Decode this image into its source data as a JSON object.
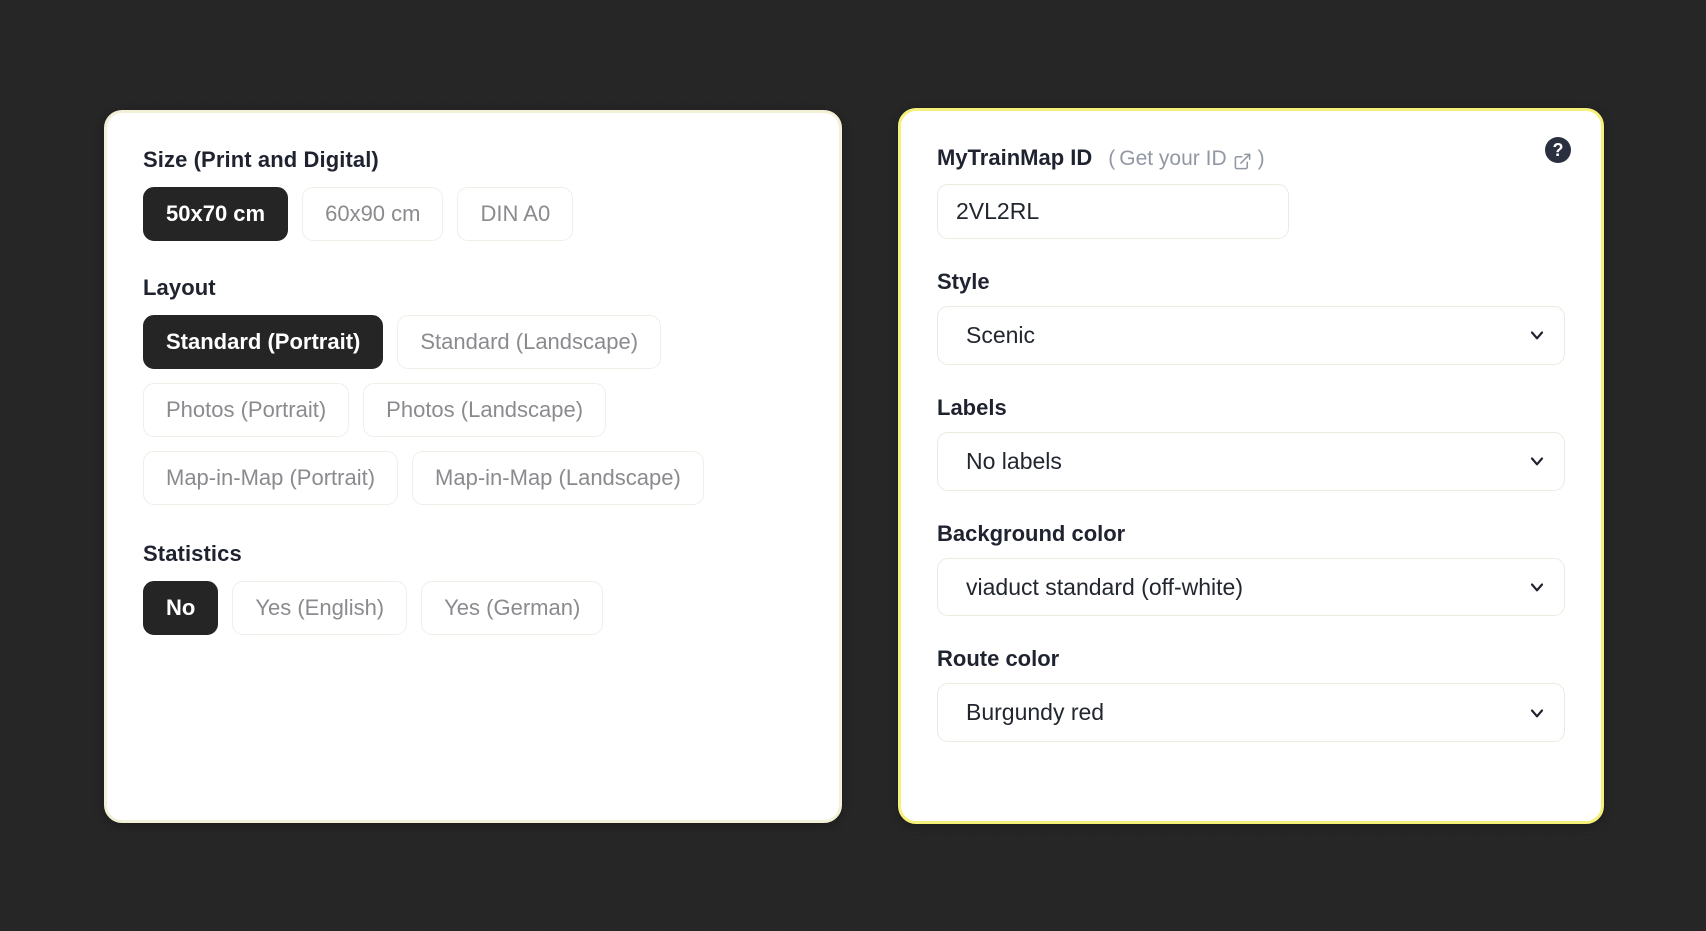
{
  "left_panel": {
    "size_group": {
      "label": "Size (Print and Digital)",
      "options": [
        {
          "label": "50x70 cm",
          "selected": true
        },
        {
          "label": "60x90 cm",
          "selected": false
        },
        {
          "label": "DIN A0",
          "selected": false
        }
      ]
    },
    "layout_group": {
      "label": "Layout",
      "options": [
        {
          "label": "Standard (Portrait)",
          "selected": true
        },
        {
          "label": "Standard (Landscape)",
          "selected": false
        },
        {
          "label": "Photos (Portrait)",
          "selected": false
        },
        {
          "label": "Photos (Landscape)",
          "selected": false
        },
        {
          "label": "Map-in-Map (Portrait)",
          "selected": false
        },
        {
          "label": "Map-in-Map (Landscape)",
          "selected": false
        }
      ]
    },
    "statistics_group": {
      "label": "Statistics",
      "options": [
        {
          "label": "No",
          "selected": true
        },
        {
          "label": "Yes (English)",
          "selected": false
        },
        {
          "label": "Yes (German)",
          "selected": false
        }
      ]
    }
  },
  "right_panel": {
    "id_field": {
      "label": "MyTrainMap ID",
      "link_open_paren": "(",
      "link_text": "Get your ID",
      "link_close_paren": ")",
      "link_icon": "external-link-icon",
      "value": "2VL2RL"
    },
    "help_icon": {
      "name": "help-icon",
      "glyph": "?"
    },
    "style_field": {
      "label": "Style",
      "value": "Scenic"
    },
    "labels_field": {
      "label": "Labels",
      "value": "No labels"
    },
    "background_color_field": {
      "label": "Background color",
      "value": "viaduct standard (off-white)"
    },
    "route_color_field": {
      "label": "Route color",
      "value": "Burgundy red"
    }
  },
  "colors": {
    "page_background": "#262626",
    "card_background": "#ffffff",
    "selected_button_background": "#252525",
    "selected_button_text": "#ffffff",
    "unselected_button_text": "#8b8b8f",
    "label_text": "#1f2330",
    "muted_text": "#9298a3",
    "left_card_border": "#f3f0d8",
    "right_card_border": "#f5f07a",
    "help_icon_background": "#2a3040"
  }
}
